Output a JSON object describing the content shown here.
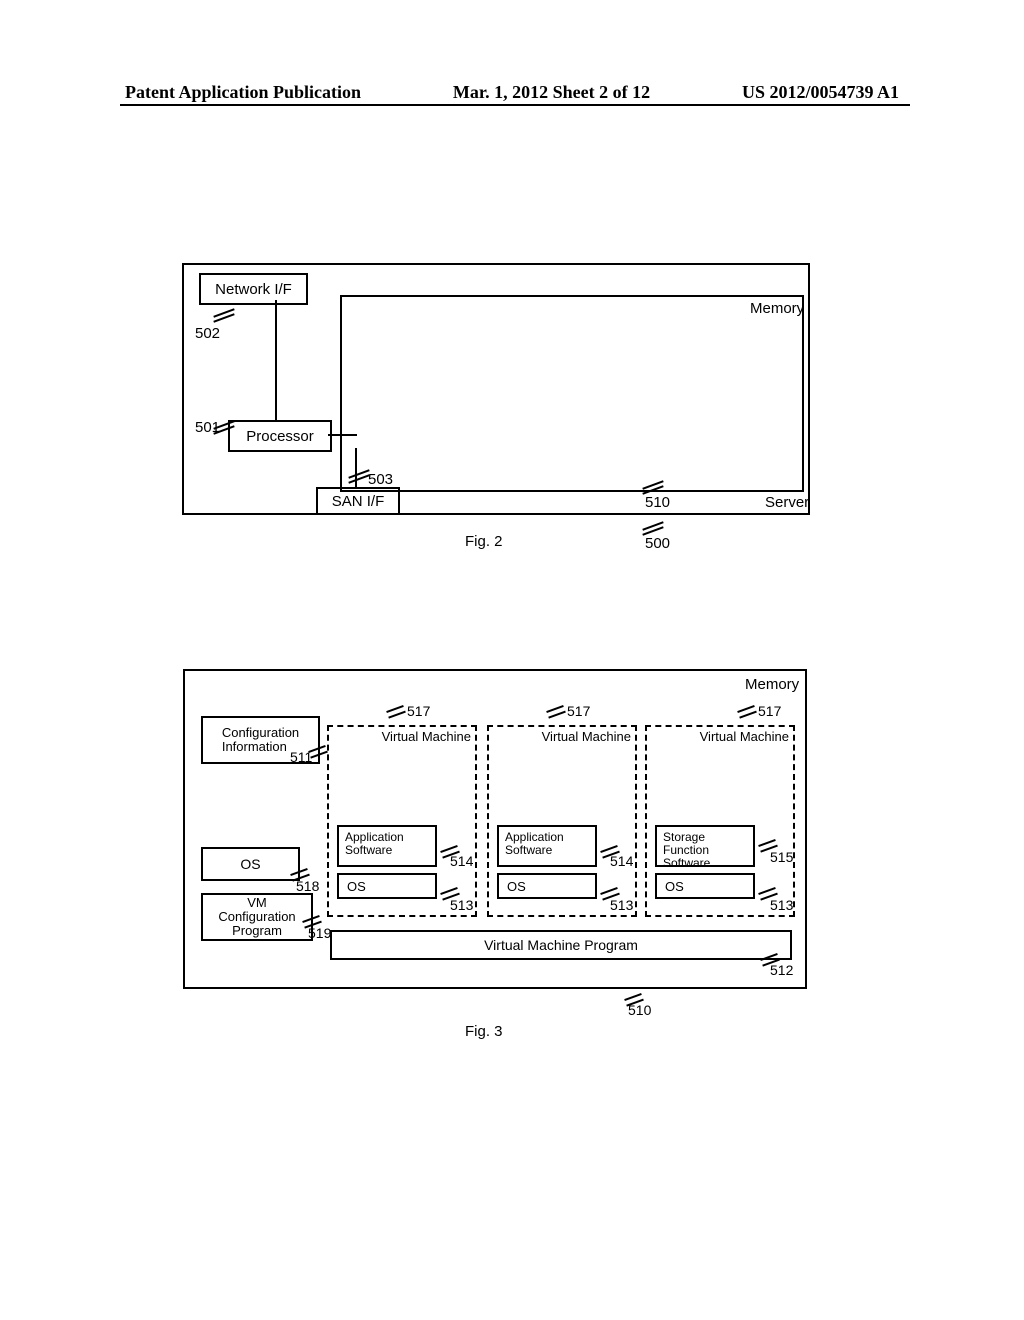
{
  "header": {
    "left": "Patent Application Publication",
    "mid": "Mar. 1, 2012  Sheet 2 of 12",
    "right": "US 2012/0054739 A1"
  },
  "fig2": {
    "caption": "Fig. 2",
    "server_label": "Server",
    "memory_label": "Memory",
    "network_if": "Network I/F",
    "processor": "Processor",
    "san_if": "SAN I/F",
    "refs": {
      "r500": "500",
      "r501": "501",
      "r502": "502",
      "r503": "503",
      "r510": "510"
    }
  },
  "fig3": {
    "caption": "Fig. 3",
    "memory_label": "Memory",
    "config_info": "Configuration\nInformation",
    "os": "OS",
    "vm_config_prog": "VM\nConfiguration\nProgram",
    "vm_program": "Virtual Machine Program",
    "vm_label": "Virtual Machine",
    "app_sw": "Application\nSoftware",
    "storage_sw": "Storage\nFunction\nSoftware",
    "refs": {
      "r510": "510",
      "r511": "511",
      "r512": "512",
      "r513": "513",
      "r514": "514",
      "r515": "515",
      "r517": "517",
      "r518": "518",
      "r519": "519"
    }
  }
}
